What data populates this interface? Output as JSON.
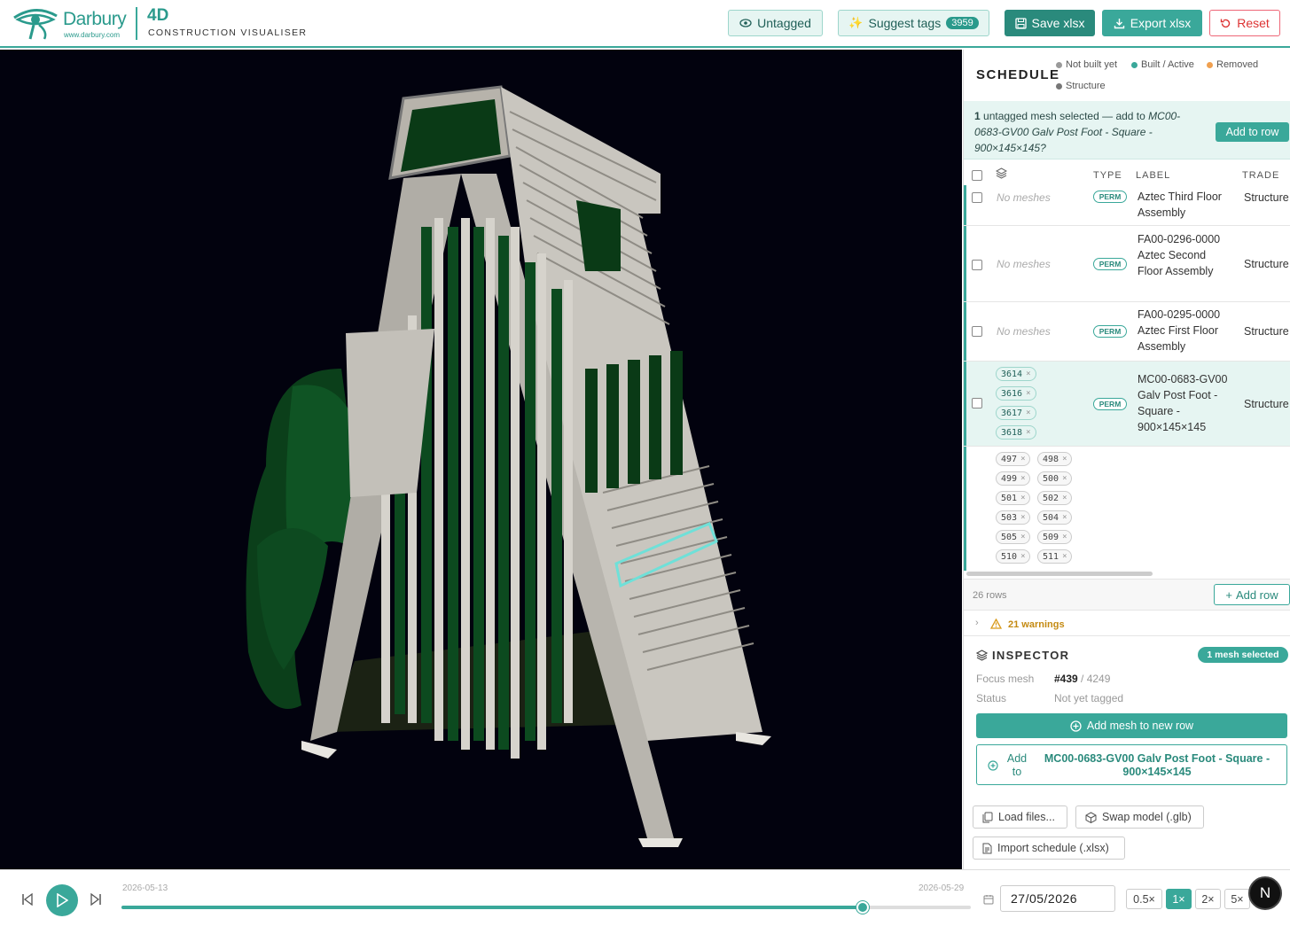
{
  "header": {
    "logo_name": "Darbury",
    "logo_url": "www.darbury.com",
    "app_name": "4D",
    "app_subtitle": "CONSTRUCTION VISUALISER",
    "untagged_label": "Untagged",
    "suggest_label": "Suggest tags",
    "suggest_count": "3959",
    "save_label": "Save xlsx",
    "export_label": "Export xlsx",
    "reset_label": "Reset"
  },
  "schedule": {
    "title": "SCHEDULE",
    "legend": [
      {
        "label": "Not built yet",
        "color": "#9a9a9a"
      },
      {
        "label": "Built / Active",
        "color": "#3aa89a"
      },
      {
        "label": "Removed",
        "color": "#f0a050"
      },
      {
        "label": "Structure",
        "color": "#777777"
      }
    ],
    "banner": {
      "count": "1",
      "text": " untagged mesh selected — add to ",
      "target": "MC00-0683-GV00 Galv Post Foot - Square - 900×145×145",
      "suffix": "?",
      "button": "Add to row"
    },
    "columns": {
      "type": "TYPE",
      "label": "LABEL",
      "trade": "TRADE"
    },
    "rows": [
      {
        "meshes": "No meshes",
        "type": "PERM",
        "label": "Aztec Third Floor Assembly",
        "trade": "Structure"
      },
      {
        "meshes": "No meshes",
        "type": "PERM",
        "label": "FA00-0296-0000 Aztec Second Floor Assembly",
        "trade": "Structure"
      },
      {
        "meshes": "No meshes",
        "type": "PERM",
        "label": "FA00-0295-0000 Aztec First Floor Assembly",
        "trade": "Structure"
      },
      {
        "chips": [
          "3614",
          "3616",
          "3617",
          "3618"
        ],
        "type": "PERM",
        "label": "MC00-0683-GV00 Galv Post Foot - Square - 900×145×145",
        "trade": "Structure"
      }
    ],
    "chips_grid": [
      "497",
      "498",
      "499",
      "500",
      "501",
      "502",
      "503",
      "504",
      "505",
      "509",
      "510",
      "511"
    ],
    "chip_remove": "×",
    "rows_count": "26 rows",
    "add_row": "Add row",
    "warnings": "21 warnings"
  },
  "inspector": {
    "title": "INSPECTOR",
    "badge": "1 mesh selected",
    "focus_key": "Focus mesh",
    "focus_id": "#439",
    "focus_total": " / 4249",
    "status_key": "Status",
    "status_val": "Not yet tagged",
    "add_new_row": "Add mesh to new row",
    "add_to_prefix": "Add to",
    "add_to_target": "MC00-0683-GV00 Galv Post Foot - Square - 900×145×145",
    "load_files": "Load files...",
    "swap_model": "Swap model (.glb)",
    "import_schedule": "Import schedule (.xlsx)"
  },
  "timeline": {
    "start_date": "2026-05-13",
    "end_date": "2026-05-29",
    "current_date": "27/05/2026",
    "progress": 0.873,
    "speeds": [
      "0.5×",
      "1×",
      "2×",
      "5×"
    ],
    "active_speed": "1×",
    "avatar_letter": "N"
  },
  "colors": {
    "accent": "#3aa89a",
    "viewport_bg": "#02020e"
  }
}
